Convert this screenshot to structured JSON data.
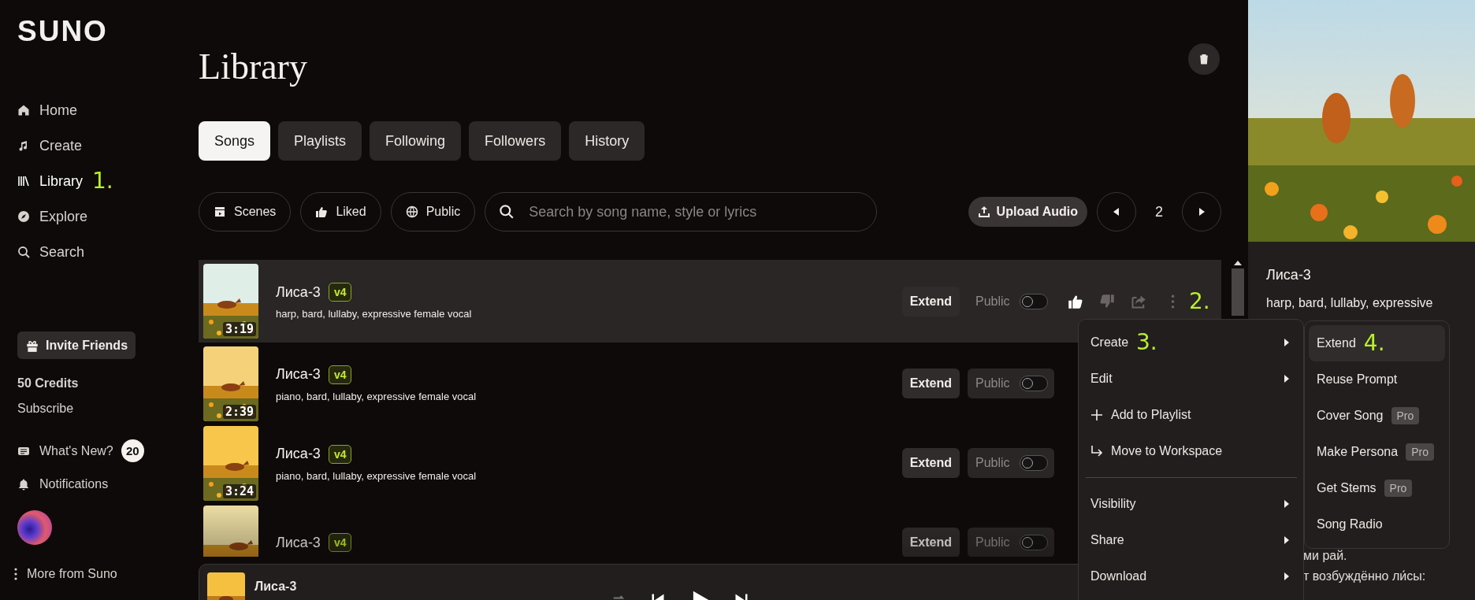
{
  "logo": "SUNO",
  "nav": [
    {
      "label": "Home",
      "selected": false
    },
    {
      "label": "Create",
      "selected": false
    },
    {
      "label": "Library",
      "selected": true,
      "annotation": "1."
    },
    {
      "label": "Explore",
      "selected": false
    },
    {
      "label": "Search",
      "selected": false
    }
  ],
  "invite": "Invite Friends",
  "credits": "50 Credits",
  "subscribe": "Subscribe",
  "whats_new": {
    "label": "What's New?",
    "badge": "20"
  },
  "notifications": "Notifications",
  "more": "More from Suno",
  "page_title": "Library",
  "tabs": [
    {
      "label": "Songs",
      "selected": true
    },
    {
      "label": "Playlists",
      "selected": false
    },
    {
      "label": "Following",
      "selected": false
    },
    {
      "label": "Followers",
      "selected": false
    },
    {
      "label": "History",
      "selected": false
    }
  ],
  "filters": [
    {
      "label": "Scenes"
    },
    {
      "label": "Liked"
    },
    {
      "label": "Public"
    }
  ],
  "search": {
    "placeholder": "Search by song name, style or lyrics"
  },
  "upload": "Upload Audio",
  "page": "2",
  "songs": [
    {
      "title": "Лиса-3",
      "version": "v4",
      "tags": "harp, bard, lullaby, expressive female vocal",
      "duration": "3:19",
      "highlighted": true,
      "extend": "Extend",
      "public_label": "Public",
      "public": false,
      "liked": true,
      "annotation": "2."
    },
    {
      "title": "Лиса-3",
      "version": "v4",
      "tags": "piano, bard, lullaby, expressive female vocal",
      "duration": "2:39",
      "highlighted": false,
      "extend": "Extend",
      "public_label": "Public",
      "public": false
    },
    {
      "title": "Лиса-3",
      "version": "v4",
      "tags": "piano, bard, lullaby, expressive female vocal",
      "duration": "3:24",
      "highlighted": false,
      "extend": "Extend",
      "public_label": "Public",
      "public": false
    },
    {
      "title": "Лиса-3",
      "version": "v4",
      "highlighted": false,
      "extend": "Extend",
      "public_label": "Public",
      "public": false
    }
  ],
  "player": {
    "title": "Лиса-3"
  },
  "detail": {
    "title": "Лиса-3",
    "tags": "harp, bard, lullaby, expressive",
    "lyrics": [
      "ми рай.",
      "т возбуждённо ли́сы:"
    ]
  },
  "menu": [
    {
      "kind": "submenu",
      "label": "Create",
      "annotation": "3."
    },
    {
      "kind": "submenu",
      "label": "Edit"
    },
    {
      "kind": "action",
      "label": "Add to Playlist"
    },
    {
      "kind": "action",
      "label": "Move to Workspace"
    },
    {
      "kind": "divider"
    },
    {
      "kind": "submenu",
      "label": "Visibility"
    },
    {
      "kind": "submenu",
      "label": "Share"
    },
    {
      "kind": "submenu",
      "label": "Download"
    }
  ],
  "submenu": [
    {
      "label": "Extend",
      "selected": true,
      "annotation": "4."
    },
    {
      "label": "Reuse Prompt",
      "selected": false
    },
    {
      "label": "Cover Song",
      "selected": false,
      "badge": "Pro"
    },
    {
      "label": "Make Persona",
      "selected": false,
      "badge": "Pro"
    },
    {
      "label": "Get Stems",
      "selected": false,
      "badge": "Pro"
    },
    {
      "label": "Song Radio",
      "selected": false
    }
  ]
}
